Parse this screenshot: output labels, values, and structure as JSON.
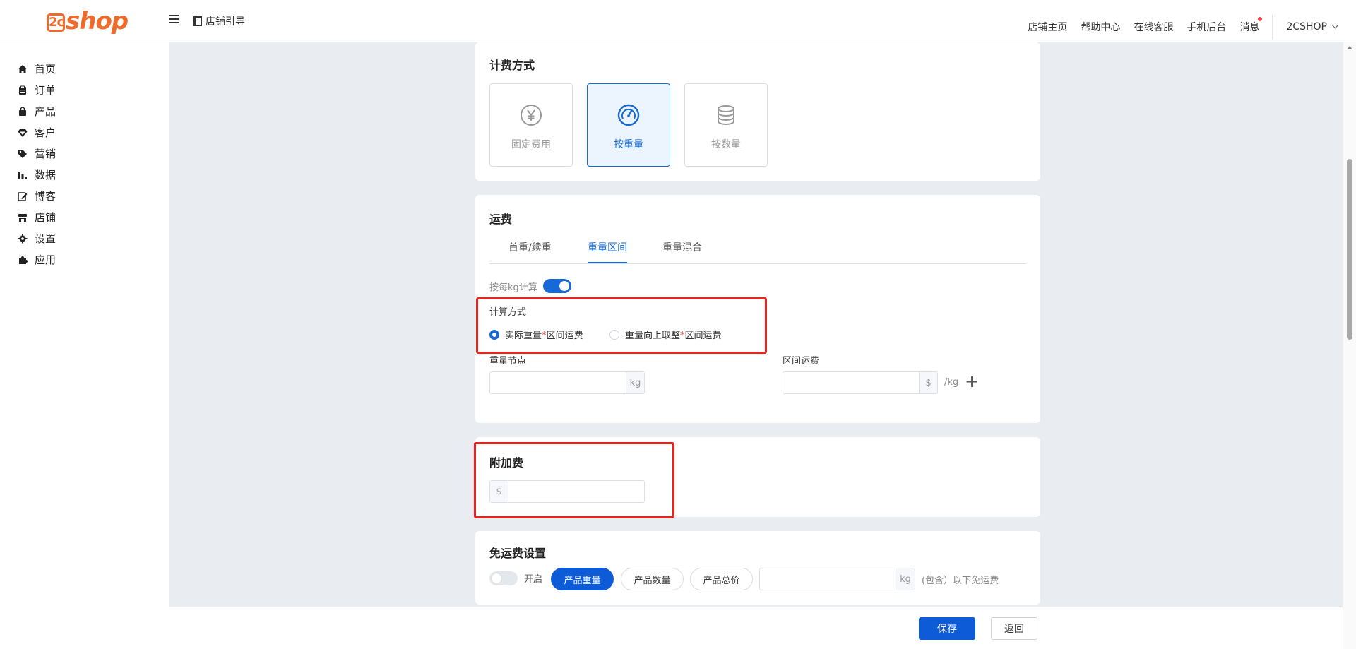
{
  "header": {
    "logo_prefix": "2c",
    "logo_text": "shop",
    "guide_label": "店铺引导",
    "links": [
      "店铺主页",
      "帮助中心",
      "在线客服",
      "手机后台",
      "消息"
    ],
    "account": "2CSHOP"
  },
  "sidebar": {
    "items": [
      {
        "label": "首页",
        "icon": "home-icon"
      },
      {
        "label": "订单",
        "icon": "clipboard-icon"
      },
      {
        "label": "产品",
        "icon": "bag-icon"
      },
      {
        "label": "客户",
        "icon": "diamond-icon"
      },
      {
        "label": "营销",
        "icon": "tag-icon"
      },
      {
        "label": "数据",
        "icon": "bar-chart-icon"
      },
      {
        "label": "博客",
        "icon": "edit-icon"
      },
      {
        "label": "店铺",
        "icon": "store-icon"
      },
      {
        "label": "设置",
        "icon": "gear-icon"
      },
      {
        "label": "应用",
        "icon": "puzzle-icon"
      }
    ]
  },
  "billing": {
    "title": "计费方式",
    "options": [
      {
        "label": "固定费用",
        "icon": "yen-icon",
        "selected": false
      },
      {
        "label": "按重量",
        "icon": "gauge-icon",
        "selected": true
      },
      {
        "label": "按数量",
        "icon": "database-icon",
        "selected": false
      }
    ]
  },
  "shipping": {
    "title": "运费",
    "tabs": [
      "首重/续重",
      "重量区间",
      "重量混合"
    ],
    "active_tab": "重量区间",
    "per_kg_label": "按每kg计算",
    "per_kg_enabled": true,
    "calc_title": "计算方式",
    "calc_options": [
      {
        "label_a": "实际重量",
        "label_b": "区间运费",
        "selected": true
      },
      {
        "label_a": "重量向上取整",
        "label_b": "区间运费",
        "selected": false
      }
    ],
    "weight_node_label": "重量节点",
    "weight_node_value": "",
    "weight_unit": "kg",
    "range_fee_label": "区间运费",
    "range_fee_value": "",
    "currency": "$",
    "per_kg_suffix": "/kg",
    "add_symbol": "+"
  },
  "surcharge": {
    "title": "附加费",
    "currency": "$",
    "value": ""
  },
  "free_shipping": {
    "title": "免运费设置",
    "enabled": false,
    "enable_label": "开启",
    "criteria": [
      "产品重量",
      "产品数量",
      "产品总价"
    ],
    "active_criterion": "产品重量",
    "value": "",
    "unit": "kg",
    "suffix": "(包含）以下免运费"
  },
  "footer": {
    "save_label": "保存",
    "back_label": "返回"
  },
  "colors": {
    "primary": "#0e5bd8",
    "accent_orange": "#f06b2b",
    "highlight_red": "#e8231b"
  }
}
